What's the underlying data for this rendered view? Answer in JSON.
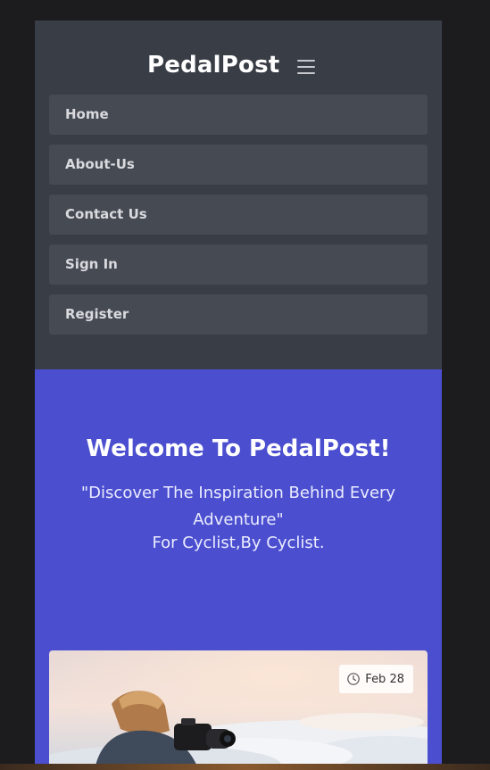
{
  "navbar": {
    "brand": "PedalPost",
    "toggler_icon": "hamburger-icon",
    "links": [
      {
        "label": "Home"
      },
      {
        "label": "About-Us"
      },
      {
        "label": "Contact Us"
      }
    ],
    "auth": [
      {
        "label": "Sign In"
      },
      {
        "label": "Register"
      }
    ]
  },
  "hero": {
    "title": "Welcome To PedalPost!",
    "subtitle": "\"Discover The Inspiration Behind Every Adventure\"",
    "tagline": "For Cyclist,By Cyclist."
  },
  "post_card": {
    "date": "Feb 28",
    "date_icon": "clock-icon"
  },
  "colors": {
    "navbar_bg": "#393d46",
    "nav_item_bg": "#464a53",
    "hero_bg": "#4b4fcf"
  }
}
